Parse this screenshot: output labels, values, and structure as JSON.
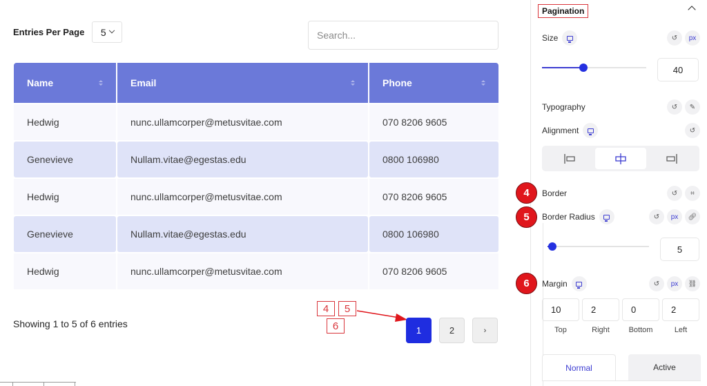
{
  "table_widget": {
    "entries_label": "Entries Per Page",
    "entries_value": "5",
    "search_placeholder": "Search...",
    "columns": [
      "Name",
      "Email",
      "Phone"
    ],
    "rows": [
      {
        "name": "Hedwig",
        "email": "nunc.ullamcorper@metusvitae.com",
        "phone": "070 8206 9605"
      },
      {
        "name": "Genevieve",
        "email": "Nullam.vitae@egestas.edu",
        "phone": "0800 106980"
      },
      {
        "name": "Hedwig",
        "email": "nunc.ullamcorper@metusvitae.com",
        "phone": "070 8206 9605"
      },
      {
        "name": "Genevieve",
        "email": "Nullam.vitae@egestas.edu",
        "phone": "0800 106980"
      },
      {
        "name": "Hedwig",
        "email": "nunc.ullamcorper@metusvitae.com",
        "phone": "070 8206 9605"
      }
    ],
    "showing_text": "Showing 1 to 5 of 6 entries",
    "pagination": {
      "pages": [
        "1",
        "2"
      ],
      "active_page": "1",
      "next_label": "›"
    }
  },
  "annotations": {
    "callout_labels": [
      "4",
      "5",
      "6"
    ],
    "accent_color": "#d9343a"
  },
  "panel": {
    "section_title": "Pagination",
    "size": {
      "label": "Size",
      "unit": "px",
      "value": "40",
      "slider_fraction": 0.4
    },
    "typography": {
      "label": "Typography"
    },
    "alignment": {
      "label": "Alignment",
      "options": [
        "left",
        "center",
        "right"
      ],
      "selected": "center"
    },
    "border": {
      "label": "Border",
      "badge": "4"
    },
    "border_radius": {
      "label": "Border Radius",
      "badge": "5",
      "unit": "px",
      "value": "5",
      "slider_fraction": 0.05
    },
    "margin": {
      "label": "Margin",
      "badge": "6",
      "unit": "px",
      "fields": [
        {
          "label": "Top",
          "value": "10"
        },
        {
          "label": "Right",
          "value": "2"
        },
        {
          "label": "Bottom",
          "value": "0"
        },
        {
          "label": "Left",
          "value": "2"
        }
      ]
    },
    "state_tabs": [
      "Normal",
      "Active"
    ],
    "active_state_tab": "Normal"
  },
  "colors": {
    "header_bg": "#6b79d9",
    "row_alt_bg": "#dfe3f8",
    "active_page_bg": "#1f2de0",
    "primary_accent": "#3b3bd1",
    "badge_red": "#e0161c"
  }
}
